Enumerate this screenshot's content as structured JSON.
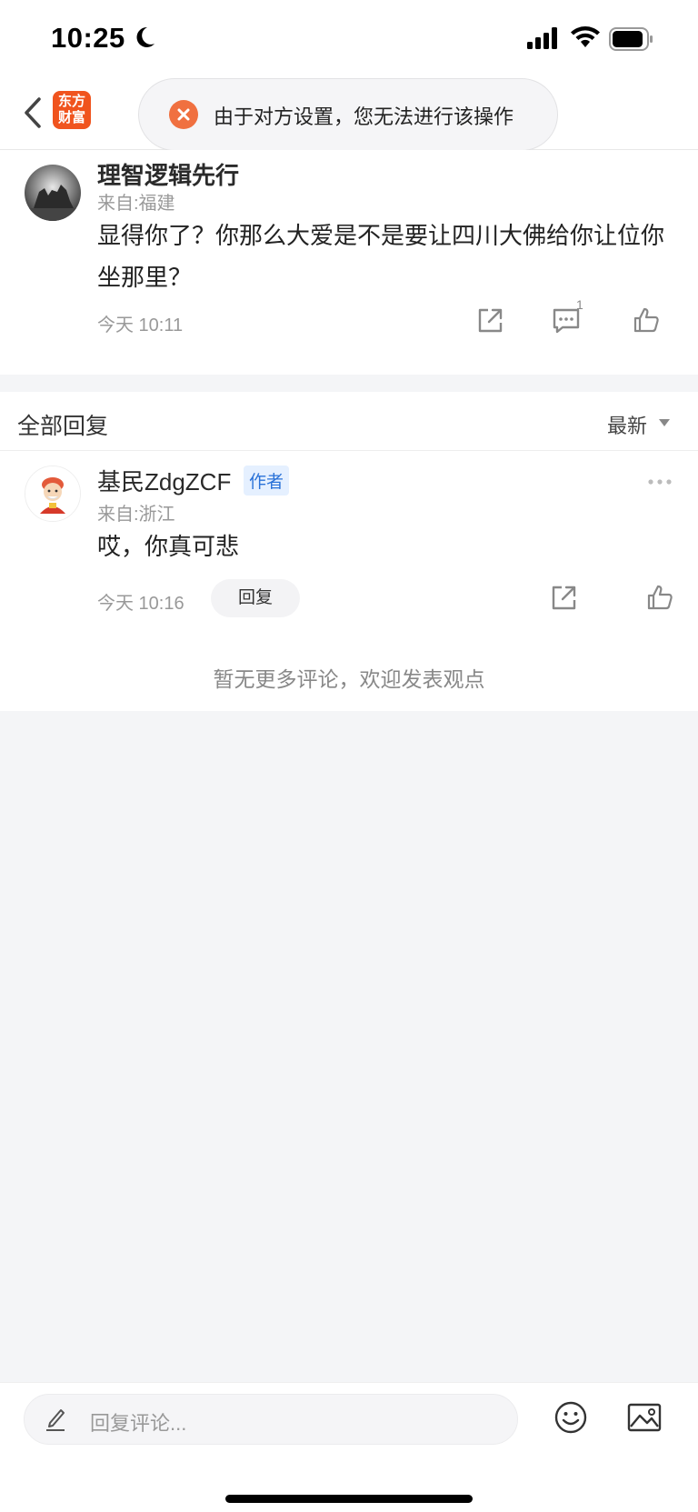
{
  "status_bar": {
    "time": "10:25"
  },
  "header": {
    "logo_text_line1": "东方",
    "logo_text_line2": "财富",
    "toast_message": "由于对方设置，您无法进行该操作"
  },
  "main_comment": {
    "username": "理智逻辑先行",
    "location": "来自:福建",
    "text": "显得你了？你那么大爱是不是要让四川大佛给你让位你坐那里？",
    "time": "今天 10:11",
    "reply_count": "1"
  },
  "replies": {
    "header_label": "全部回复",
    "sort_label": "最新",
    "items": [
      {
        "username": "基民ZdgZCF",
        "badge": "作者",
        "location": "来自:浙江",
        "text": "哎，你真可悲",
        "time": "今天 10:16",
        "reply_button": "回复"
      }
    ],
    "no_more_text": "暂无更多评论，欢迎发表观点"
  },
  "bottom_bar": {
    "input_placeholder": "回复评论..."
  },
  "colors": {
    "brand": "#f0541e",
    "toast_icon": "#f07040",
    "badge": "#2a72d8"
  }
}
